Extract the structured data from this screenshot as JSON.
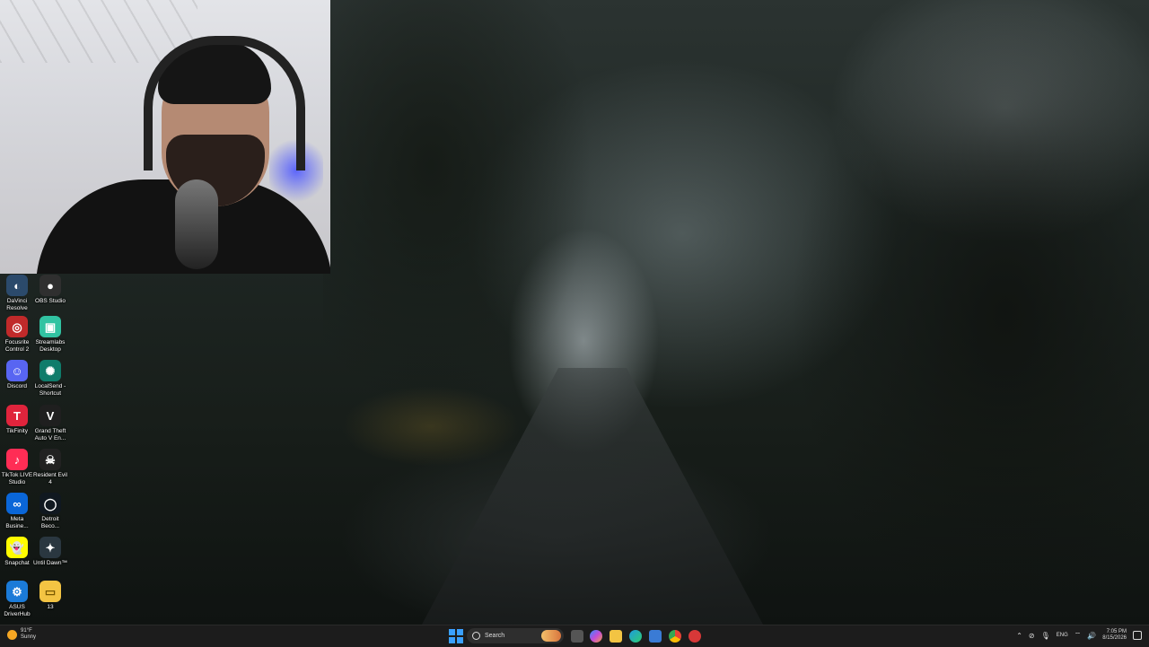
{
  "desktop": {
    "icons": [
      {
        "label": "DaVinci Resolve",
        "icon": "davinci-resolve-icon",
        "color": "#2b4a6b",
        "glyph": "◐"
      },
      {
        "label": "OBS Studio",
        "icon": "obs-studio-icon",
        "color": "#2f2f2f",
        "glyph": "●"
      },
      {
        "label": "Focusrite Control 2",
        "icon": "focusrite-icon",
        "color": "#c02a2a",
        "glyph": "◎"
      },
      {
        "label": "Streamlabs Desktop",
        "icon": "streamlabs-icon",
        "color": "#31c3a2",
        "glyph": "▣"
      },
      {
        "label": "Discord",
        "icon": "discord-icon",
        "color": "#5865f2",
        "glyph": "☺"
      },
      {
        "label": "LocalSend - Shortcut",
        "icon": "localsend-icon",
        "color": "#0f7c6b",
        "glyph": "✺"
      },
      {
        "label": "TikFinity",
        "icon": "tikfinity-icon",
        "color": "#e0243c",
        "glyph": "T"
      },
      {
        "label": "Grand Theft Auto V En...",
        "icon": "gta-v-icon",
        "color": "#1f1f1f",
        "glyph": "V"
      },
      {
        "label": "TikTok LIVE Studio",
        "icon": "tiktok-live-icon",
        "color": "#ff2d55",
        "glyph": "♪"
      },
      {
        "label": "Resident Evil 4",
        "icon": "resident-evil-icon",
        "color": "#222222",
        "glyph": "☠"
      },
      {
        "label": "Meta Busine...",
        "icon": "meta-icon",
        "color": "#0a66d8",
        "glyph": "∞"
      },
      {
        "label": "Detroit Beco...",
        "icon": "detroit-icon",
        "color": "#101820",
        "glyph": "◯"
      },
      {
        "label": "Snapchat",
        "icon": "snapchat-icon",
        "color": "#fffc00",
        "glyph": "👻"
      },
      {
        "label": "Until Dawn™",
        "icon": "until-dawn-icon",
        "color": "#2a3740",
        "glyph": "✦"
      },
      {
        "label": "ASUS DriverHub",
        "icon": "asus-driverhub-icon",
        "color": "#1b7bd8",
        "glyph": "⚙"
      },
      {
        "label": "13",
        "icon": "folder-icon",
        "color": "#f3c443",
        "glyph": "▭"
      }
    ]
  },
  "taskbar": {
    "weather": {
      "temp": "91°F",
      "condition": "Sunny"
    },
    "search_placeholder": "Search",
    "apps": [
      {
        "name": "task-view",
        "color": "#555555"
      },
      {
        "name": "copilot",
        "color": "#c34bd8"
      },
      {
        "name": "file-explorer",
        "color": "#f3c443"
      },
      {
        "name": "edge",
        "color": "#1f9be0"
      },
      {
        "name": "microsoft-store",
        "color": "#3a7bd5"
      },
      {
        "name": "chrome",
        "color": "#e84335"
      },
      {
        "name": "recorder",
        "color": "#d73838"
      }
    ],
    "tray": {
      "language": "ENG",
      "time": "7:05 PM",
      "date": "8/15/2026"
    }
  }
}
